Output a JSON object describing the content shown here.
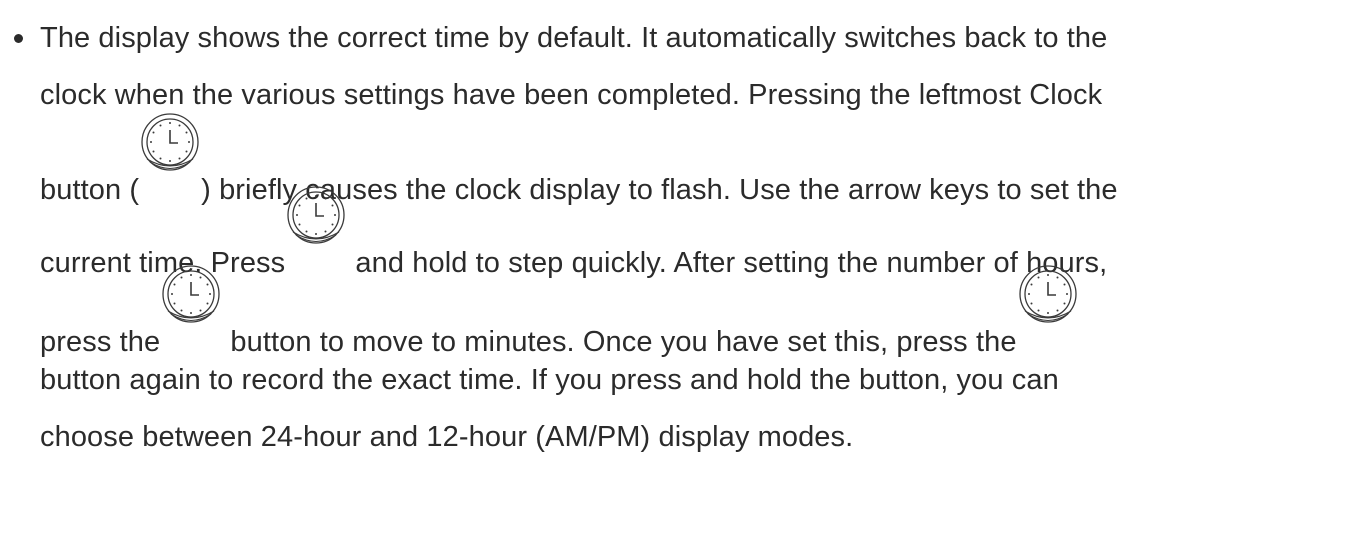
{
  "paragraph": {
    "line1": "The display shows the correct time by default. It automatically switches back to the",
    "line2": "clock when the various settings have been completed. Pressing the leftmost Clock",
    "line3_a": "button (",
    "line3_b": ") briefly causes the clock display to flash. Use the arrow keys to set the",
    "line4_a": "current time. Press",
    "line4_b": "and hold to step quickly. After setting the number of hours,",
    "line5_a": "press the",
    "line5_b": "button to move to minutes. Once you have set this, press the",
    "line6": "button again to record the exact time. If you press and hold the button, you can",
    "line7": "choose between 24-hour and 12-hour (AM/PM) display modes."
  },
  "icons": {
    "clock_button_icon": "clock-icon"
  }
}
